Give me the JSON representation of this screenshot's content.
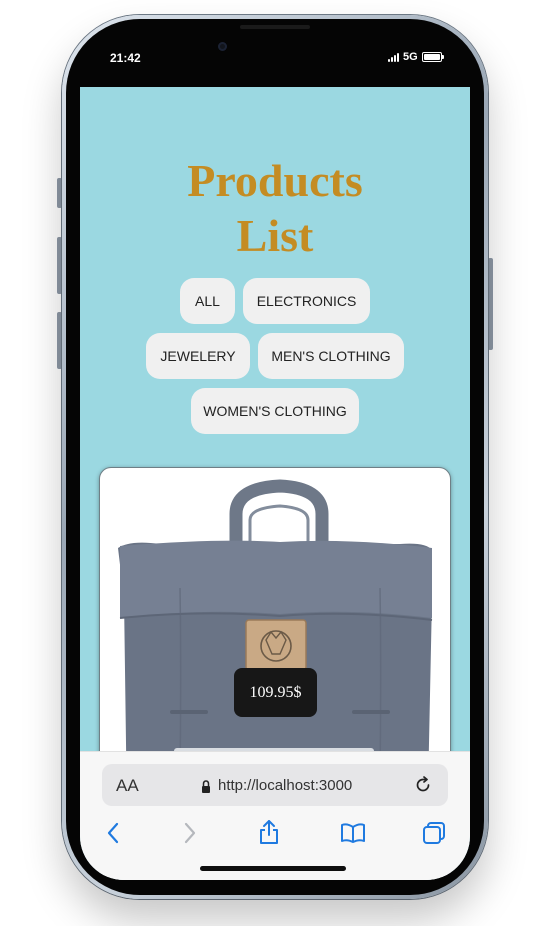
{
  "status_bar": {
    "time": "21:42",
    "network": "5G"
  },
  "page": {
    "title_line1": "Products",
    "title_line2": "List",
    "filters": [
      {
        "label": "ALL"
      },
      {
        "label": "ELECTRONICS"
      },
      {
        "label": "JEWELERY"
      },
      {
        "label": "MEN'S CLOTHING"
      },
      {
        "label": "WOMEN'S CLOTHING"
      }
    ],
    "products": [
      {
        "price": "109.95$",
        "image": "backpack-icon"
      }
    ]
  },
  "browser": {
    "text_size_label": "AA",
    "url": "http://localhost:3000",
    "icons": [
      "lock-icon",
      "reload-icon",
      "back-icon",
      "forward-icon",
      "share-icon",
      "bookmarks-icon",
      "tabs-icon"
    ]
  },
  "colors": {
    "background": "#9bd8e1",
    "title": "#c48c23",
    "filter_button": "#f0f0f0",
    "price_tag": "#171717",
    "ios_blue": "#1f7ae0"
  }
}
